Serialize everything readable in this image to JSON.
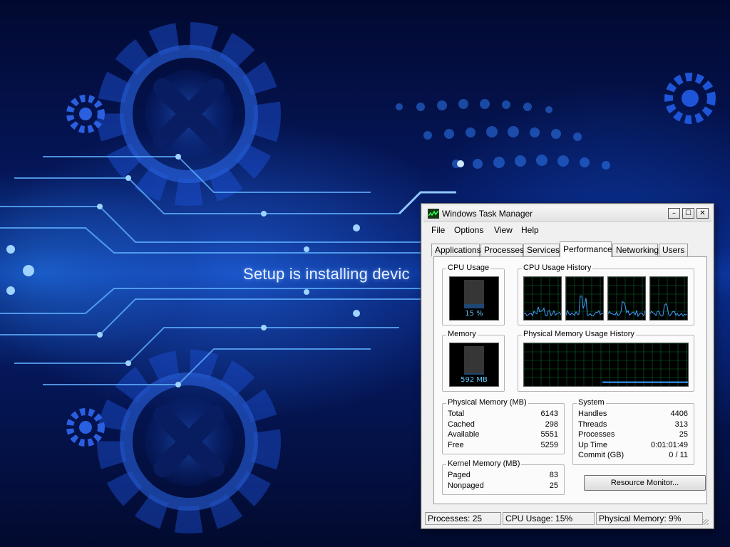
{
  "desktop": {
    "setup_text": "Setup is installing devic"
  },
  "window": {
    "title": "Windows Task Manager",
    "icon": "task-manager-icon",
    "controls": {
      "minimize": "–",
      "maximize": "☐",
      "close": "✕"
    }
  },
  "menu": [
    "File",
    "Options",
    "View",
    "Help"
  ],
  "tabs": [
    {
      "label": "Applications",
      "active": false
    },
    {
      "label": "Processes",
      "active": false
    },
    {
      "label": "Services",
      "active": false
    },
    {
      "label": "Performance",
      "active": true
    },
    {
      "label": "Networking",
      "active": false
    },
    {
      "label": "Users",
      "active": false
    }
  ],
  "performance": {
    "cpu_usage": {
      "label": "CPU Usage",
      "value_text": "15 %",
      "fraction": 0.15
    },
    "cpu_history": {
      "label": "CPU Usage History",
      "cores": 4
    },
    "memory": {
      "label": "Memory",
      "value_text": "592 MB",
      "fraction": 0.09
    },
    "memory_history": {
      "label": "Physical Memory Usage History",
      "fraction": 0.09
    },
    "physical_memory": {
      "label": "Physical Memory (MB)",
      "rows": [
        {
          "key": "Total",
          "value": "6143"
        },
        {
          "key": "Cached",
          "value": "298"
        },
        {
          "key": "Available",
          "value": "5551"
        },
        {
          "key": "Free",
          "value": "5259"
        }
      ]
    },
    "kernel_memory": {
      "label": "Kernel Memory (MB)",
      "rows": [
        {
          "key": "Paged",
          "value": "83"
        },
        {
          "key": "Nonpaged",
          "value": "25"
        }
      ]
    },
    "system": {
      "label": "System",
      "rows": [
        {
          "key": "Handles",
          "value": "4406"
        },
        {
          "key": "Threads",
          "value": "313"
        },
        {
          "key": "Processes",
          "value": "25"
        },
        {
          "key": "Up Time",
          "value": "0:01:01:49"
        },
        {
          "key": "Commit (GB)",
          "value": "0 / 11"
        }
      ]
    },
    "resource_monitor_button": "Resource Monitor..."
  },
  "status": {
    "processes": "Processes: 25",
    "cpu": "CPU Usage: 15%",
    "memory": "Physical Memory: 9%"
  },
  "colors": {
    "graph_line": "#3fa0ff",
    "meter_fill": "#3c8fe8",
    "grid": "#0a6a2a"
  }
}
